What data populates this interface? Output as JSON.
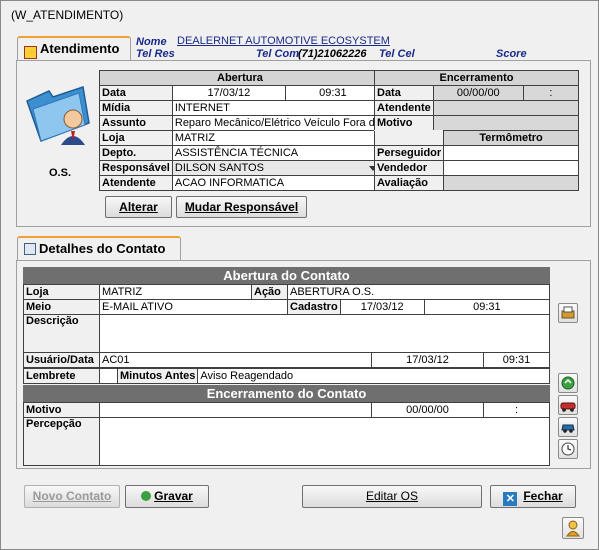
{
  "window": {
    "title": "(W_ATENDIMENTO)"
  },
  "tab_atendimento": {
    "label": "Atendimento"
  },
  "header": {
    "nome_label": "Nome",
    "nome_value": "DEALERNET AUTOMOTIVE ECOSYSTEM",
    "telres_label": "Tel Res",
    "telcom_label": "Tel Com",
    "telcom_value": "(71)21062226",
    "telcel_label": "Tel Cel",
    "score_label": "Score"
  },
  "os_label": "O.S.",
  "abertura": {
    "title": "Abertura",
    "data_label": "Data",
    "data_value": "17/03/12",
    "hora_value": "09:31",
    "midia_label": "Mídia",
    "midia_value": "INTERNET",
    "assunto_label": "Assunto",
    "assunto_value": "Reparo Mecânico/Elétrico Veículo Fora de",
    "loja_label": "Loja",
    "loja_value": "MATRIZ",
    "depto_label": "Depto.",
    "depto_value": "ASSISTÊNCIA TÉCNICA",
    "responsavel_label": "Responsável",
    "responsavel_value": "DILSON SANTOS",
    "atendente_label": "Atendente",
    "atendente_value": "ACAO INFORMATICA"
  },
  "encerramento": {
    "title": "Encerramento",
    "data_label": "Data",
    "data_value": "00/00/00",
    "hora_value": ":",
    "atendente_label": "Atendente",
    "motivo_label": "Motivo"
  },
  "termometro": {
    "title": "Termômetro",
    "perseguidor_label": "Perseguidor",
    "vendedor_label": "Vendedor",
    "avaliacao_label": "Avaliação"
  },
  "buttons": {
    "alterar": "Alterar",
    "mudar_responsavel": "Mudar Responsável",
    "novo_contato": "Novo Contato",
    "gravar": "Gravar",
    "editar_os": "Editar OS",
    "fechar": "Fechar"
  },
  "tab_detalhes": {
    "label": "Detalhes do Contato"
  },
  "contato": {
    "abertura_title": "Abertura do Contato",
    "loja_label": "Loja",
    "loja_value": "MATRIZ",
    "acao_label": "Ação",
    "acao_value": "ABERTURA O.S.",
    "meio_label": "Meio",
    "meio_value": "E-MAIL ATIVO",
    "cadastro_label": "Cadastro",
    "cadastro_date": "17/03/12",
    "cadastro_hora": "09:31",
    "descricao_label": "Descrição",
    "usuario_label": "Usuário/Data",
    "usuario_value": "AC01",
    "usuario_date": "17/03/12",
    "usuario_hora": "09:31",
    "lembrete_label": "Lembrete",
    "minutos_label": "Minutos Antes",
    "minutos_value": "Aviso Reagendado",
    "encerramento_title": "Encerramento do Contato",
    "motivo_label": "Motivo",
    "motivo_date": "00/00/00",
    "motivo_hora": ":",
    "percepcao_label": "Percepção"
  }
}
